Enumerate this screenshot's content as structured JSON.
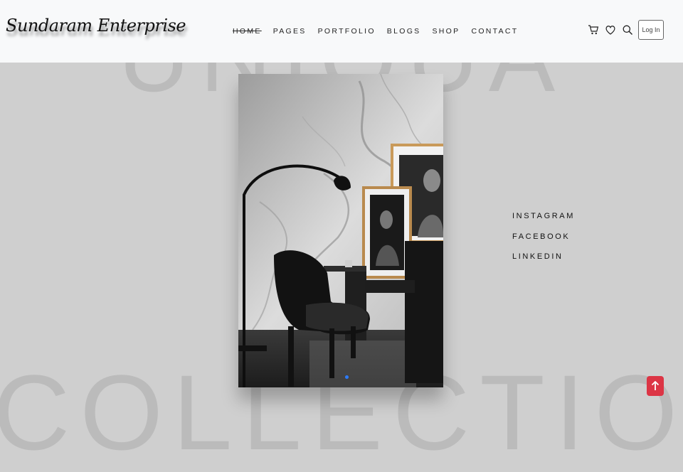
{
  "background": {
    "top_word": "UNIQUA",
    "bottom_word": "COLLECTION"
  },
  "header": {
    "logo": "Sundaram Enterprise",
    "nav": [
      {
        "label": "HOME",
        "active": true
      },
      {
        "label": "PAGES"
      },
      {
        "label": "PORTFOLIO"
      },
      {
        "label": "BLOGS"
      },
      {
        "label": "SHOP"
      },
      {
        "label": "CONTACT"
      }
    ],
    "icons": [
      "cart-icon",
      "heart-icon",
      "search-icon"
    ],
    "login_label": "Log In"
  },
  "hero": {
    "image": "interior-chair-lamp-photo",
    "slide_indicator_color": "#2b7bff"
  },
  "social": [
    {
      "label": "INSTAGRAM"
    },
    {
      "label": "FACEBOOK"
    },
    {
      "label": "LINKEDIN"
    }
  ],
  "back_to_top": {
    "icon": "arrow-up-icon",
    "color": "#dc3545"
  }
}
